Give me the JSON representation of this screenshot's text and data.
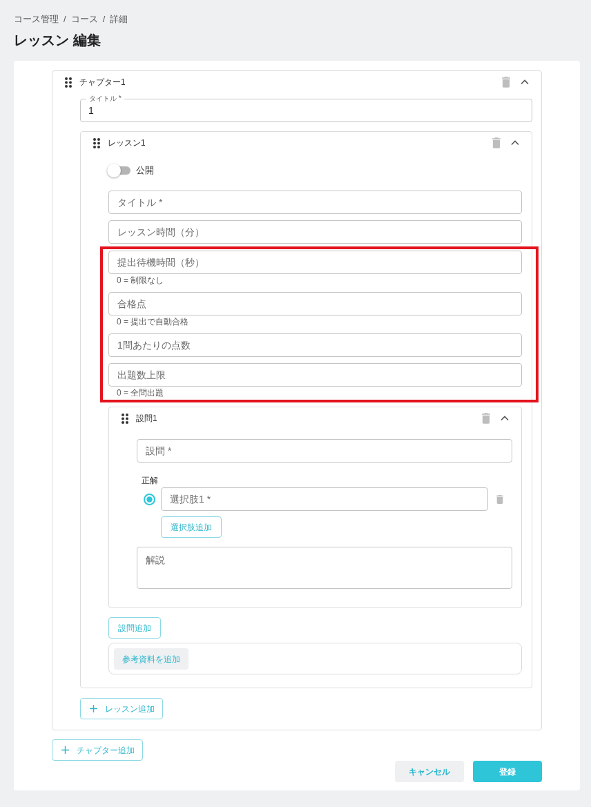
{
  "breadcrumb": [
    {
      "kind": "item",
      "text": "コース管理"
    },
    {
      "kind": "separator",
      "text": "/"
    },
    {
      "kind": "item",
      "text": "コース"
    },
    {
      "kind": "separator",
      "text": "/"
    },
    {
      "kind": "item",
      "text": "詳細"
    }
  ],
  "page_title": "レッスン 編集",
  "chapters": [
    {
      "label": "チャプター1",
      "expanded": true,
      "title_field": {
        "label": "タイトル *",
        "value": "1"
      },
      "lessons": [
        {
          "label": "レッスン1",
          "expanded": true,
          "publish_switch": {
            "label": "公開",
            "on": false
          },
          "fields": [
            {
              "placeholder": "タイトル *",
              "highlighted": false
            },
            {
              "placeholder": "レッスン時間（分）",
              "highlighted": false
            },
            {
              "placeholder": "提出待機時間（秒）",
              "helper": "0 = 制限なし",
              "highlighted": true
            },
            {
              "placeholder": "合格点",
              "helper": "0 = 提出で自動合格",
              "highlighted": true
            },
            {
              "placeholder": "1問あたりの点数",
              "highlighted": true
            },
            {
              "placeholder": "出題数上限",
              "helper": "0 = 全問出題",
              "highlighted": true
            }
          ],
          "questions": [
            {
              "label": "設問1",
              "expanded": true,
              "question_field": {
                "placeholder": "設問 *"
              },
              "answer_label": "正解",
              "choices": [
                {
                  "placeholder": "選択肢1 *",
                  "selected": true
                }
              ],
              "add_choice_button": "選択肢追加",
              "explanation_field": {
                "placeholder": "解説"
              }
            }
          ],
          "add_question_button": "設問追加",
          "add_reference_button": "参考資料を追加"
        }
      ],
      "add_lesson_button": "レッスン追加"
    }
  ],
  "add_chapter_button": "チャプター追加",
  "actions": [
    {
      "kind": "cancel",
      "label": "キャンセル"
    },
    {
      "kind": "submit",
      "label": "登録"
    }
  ]
}
